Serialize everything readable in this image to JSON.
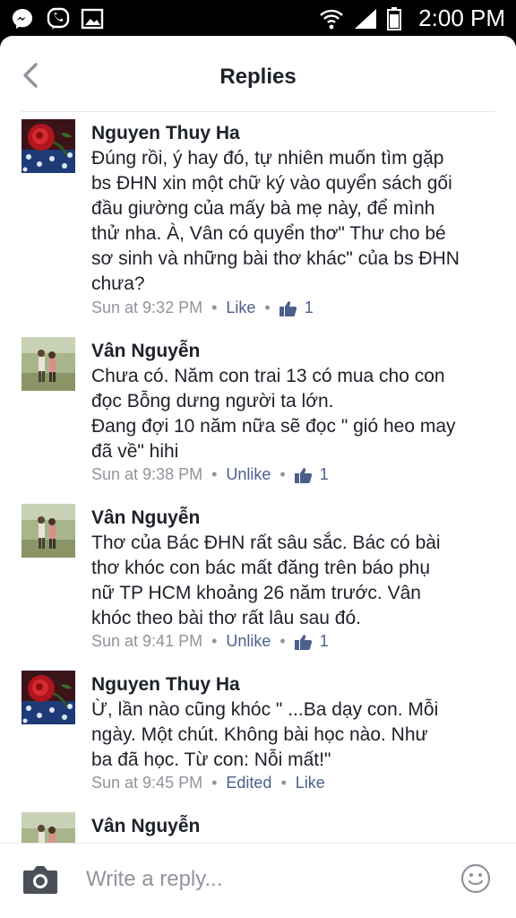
{
  "status_bar": {
    "time": "2:00 PM",
    "icons": [
      "messenger-icon",
      "viber-icon",
      "gallery-icon",
      "wifi-icon",
      "signal-icon",
      "battery-icon"
    ]
  },
  "header": {
    "title": "Replies",
    "back_icon": "back-chevron-icon"
  },
  "comments": [
    {
      "author": "Nguyen Thuy Ha",
      "avatar": "rose-avatar",
      "lines": [
        "Đúng rồi, ý hay đó, tự nhiên muốn tìm gặp",
        "bs ĐHN xin một chữ ký vào quyển sách gối",
        "đầu giường của mấy bà mẹ này, để mình",
        "thử nha. À, Vân có quyển thơ\" Thư cho bé",
        "sơ sinh và những bài thơ khác\" của bs ĐHN",
        "chưa?"
      ],
      "time": "Sun at 9:32 PM",
      "action": "Like",
      "likes": "1"
    },
    {
      "author": "Vân Nguyễn",
      "avatar": "field-avatar",
      "lines": [
        "Chưa có. Năm con trai 13 có mua cho con",
        "đọc Bỗng dưng người ta lớn.",
        "Đang đợi 10 năm nữa sẽ đọc \" gió heo may",
        "đã về\" hihi"
      ],
      "time": "Sun at 9:38 PM",
      "action": "Unlike",
      "likes": "1"
    },
    {
      "author": "Vân Nguyễn",
      "avatar": "field-avatar",
      "lines": [
        "Thơ của Bác ĐHN rất sâu sắc. Bác có bài",
        "thơ khóc con bác mất đăng trên báo phụ",
        "nữ TP HCM khoảng 26 năm trước. Vân",
        "khóc theo bài thơ rất lâu sau đó."
      ],
      "time": "Sun at 9:41 PM",
      "action": "Unlike",
      "likes": "1"
    },
    {
      "author": "Nguyen Thuy Ha",
      "avatar": "rose-avatar",
      "lines": [
        "Ừ, lần nào cũng khóc \" ...Ba dạy con. Mỗi",
        "ngày. Một chút. Không bài học nào. Như",
        "ba đã học. Từ con: Nỗi mất!\""
      ],
      "time": "Sun at 9:45 PM",
      "edited": "Edited",
      "action": "Like"
    },
    {
      "author": "Vân Nguyễn",
      "avatar": "field-avatar"
    }
  ],
  "reply_bar": {
    "placeholder": "Write a reply...",
    "camera_icon": "camera-icon",
    "emoji_icon": "emoji-icon"
  },
  "colors": {
    "link": "#4b5f8d",
    "meta": "#90949c",
    "text": "#1d2129"
  }
}
